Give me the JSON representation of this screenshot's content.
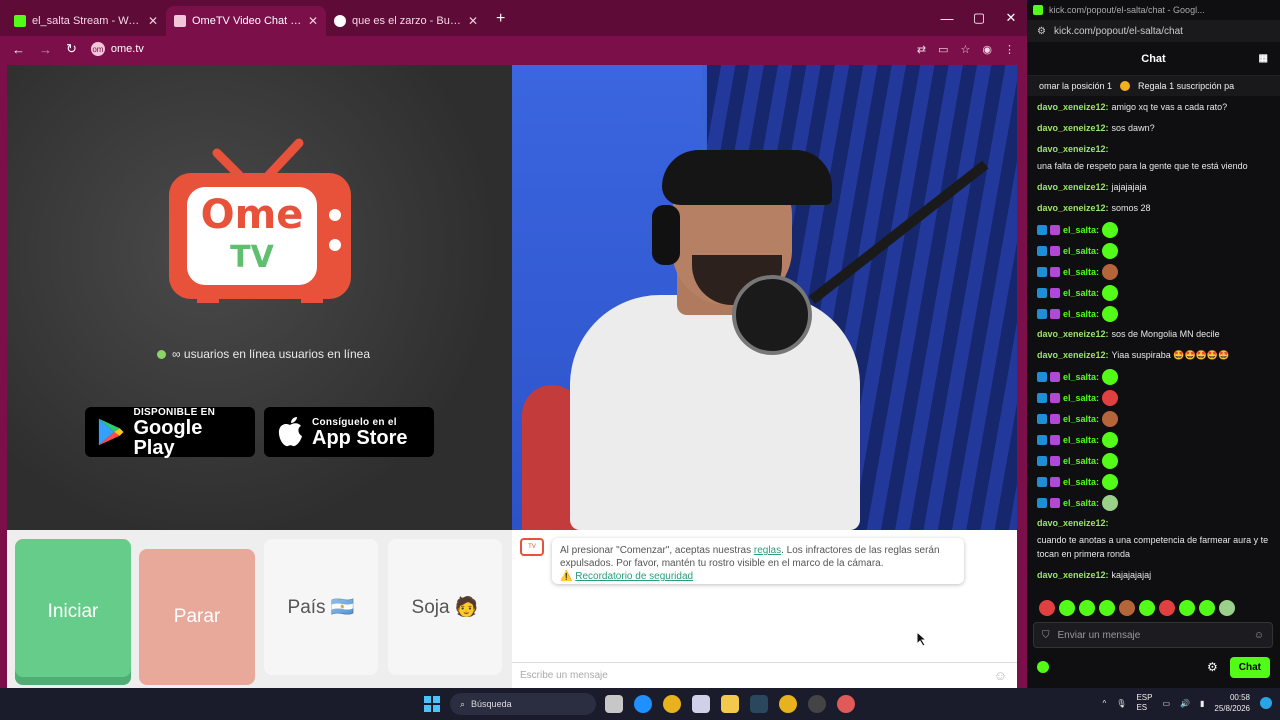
{
  "browser": {
    "tabs": [
      {
        "title": "el_salta Stream - Watch Live on Kick",
        "close": "✕"
      },
      {
        "title": "OmeTV Video Chat — Alternative",
        "close": "✕"
      },
      {
        "title": "que es el zarzo - Buscar con Google",
        "close": "✕"
      }
    ],
    "new_tab": "+",
    "window_controls": {
      "minimize": "—",
      "maximize": "▢",
      "close": "✕"
    },
    "nav": {
      "back": "←",
      "forward": "→",
      "reload": "↻"
    },
    "url": "ome.tv",
    "url_badge": "om"
  },
  "ometv": {
    "logo_top": "Ome",
    "logo_bottom": "TV",
    "online_text": "∞ usuarios en línea usuarios en línea",
    "google_play": {
      "small": "DISPONIBLE EN",
      "big": "Google Play"
    },
    "app_store": {
      "small": "Consíguelo en el",
      "big": "App Store"
    },
    "buttons": {
      "start": "Iniciar",
      "stop": "Parar",
      "country": "País 🇦🇷",
      "gender": "Soja 🧑"
    },
    "notice": {
      "text_before": "Al presionar \"Comenzar\", aceptas nuestras ",
      "link": "reglas",
      "text_after": ". Los infractores de las reglas serán expulsados. Por favor, mantén tu rostro visible en el marco de la cámara.",
      "reminder_icon": "⚠️",
      "reminder": "Recordatorio de seguridad"
    },
    "message_placeholder": "Escribe un mensaje",
    "colors": {
      "brand": "#e8523a",
      "start": "#66cc8a",
      "stop": "#e8a99a"
    }
  },
  "kick": {
    "window_title": "kick.com/popout/el-salta/chat - Googl...",
    "url": "kick.com/popout/el-salta/chat",
    "header": "Chat",
    "pinned": {
      "left": "omar la posición 1",
      "right": "Regala 1 suscripción pa"
    },
    "messages": [
      {
        "user": "davo_xeneize12:",
        "text": "amigo xq te vas a cada rato?"
      },
      {
        "user": "davo_xeneize12:",
        "text": "sos dawn?"
      },
      {
        "user": "davo_xeneize12:",
        "text": "una falta de respeto para la gente que te está viendo"
      },
      {
        "user": "davo_xeneize12:",
        "text": "jajajajaja"
      },
      {
        "user": "davo_xeneize12:",
        "text": "somos 28"
      },
      {
        "user": "el_salta:",
        "text": ""
      },
      {
        "user": "el_salta:",
        "text": ""
      },
      {
        "user": "el_salta:",
        "text": ""
      },
      {
        "user": "el_salta:",
        "text": ""
      },
      {
        "user": "el_salta:",
        "text": ""
      },
      {
        "user": "davo_xeneize12:",
        "text": "sos de Mongolia MN decile"
      },
      {
        "user": "davo_xeneize12:",
        "text": "Yiaa suspiraba 🤩🤩🤩🤩🤩"
      },
      {
        "user": "el_salta:",
        "text": ""
      },
      {
        "user": "el_salta:",
        "text": ""
      },
      {
        "user": "el_salta:",
        "text": ""
      },
      {
        "user": "el_salta:",
        "text": ""
      },
      {
        "user": "el_salta:",
        "text": ""
      },
      {
        "user": "el_salta:",
        "text": ""
      },
      {
        "user": "el_salta:",
        "text": ""
      },
      {
        "user": "davo_xeneize12:",
        "text": "cuando te anotas a una competencia de farmear aura y te tocan en primera ronda"
      },
      {
        "user": "davo_xeneize12:",
        "text": "kajajajajaj"
      }
    ],
    "input_placeholder": "Enviar un mensaje",
    "send_button": "Chat",
    "colors": {
      "accent": "#53fc18"
    }
  },
  "taskbar": {
    "search": "Búsqueda",
    "lang": "ESP\nES",
    "time": "00:58",
    "date": "25/8/2026"
  }
}
